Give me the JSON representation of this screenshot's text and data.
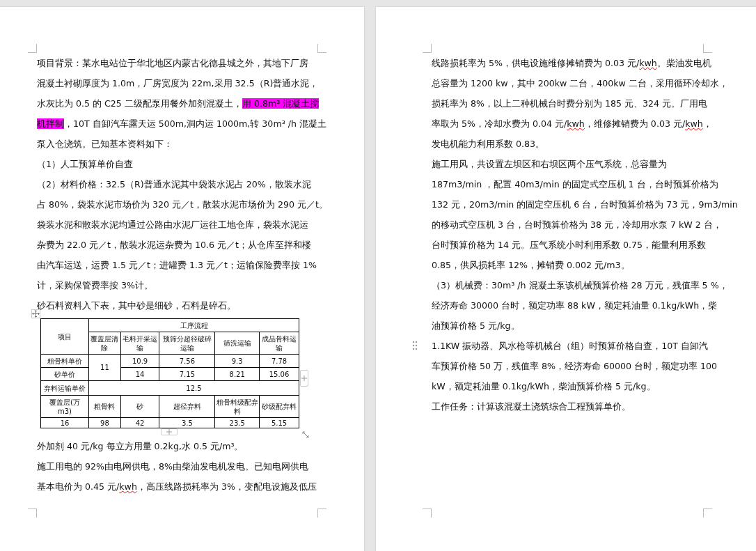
{
  "pages": [
    {
      "blocks": [
        {
          "kind": "paragraph",
          "lines": [
            [
              "项目背景：某水电站位于华北地区内蒙古化德县城之外，其地下厂房"
            ],
            [
              "混凝土衬砌厚度为 1.0m，厂房宽度为 22m,采用 32.5（R)普通水泥，"
            ],
            [
              "水灰比为 0.5 的 C25 二级配泵用餐外加剂混凝土，",
              {
                "text": "用 0.8m³ 混凝土搅",
                "highlight": true
              }
            ],
            [
              {
                "text": "机拌制",
                "highlight": true
              },
              "，10T 自卸汽车露天运 500m,洞内运 1000m,转 30m³ /h 混凝土"
            ],
            [
              "泵入仓浇筑。已知基本资料如下："
            ]
          ]
        },
        {
          "kind": "paragraph",
          "lines": [
            [
              "（1）人工预算单价自查"
            ]
          ]
        },
        {
          "kind": "paragraph",
          "lines": [
            [
              "（2）材料价格：32.5（R)普通水泥其中袋装水泥占 20%，散装水泥"
            ],
            [
              "占 80%，袋装水泥市场价为 320 元／t，散装水泥市场价为 290 元／t。"
            ],
            [
              "袋装水泥和散装水泥均通过公路由水泥厂运往工地仓库，袋装水泥运"
            ],
            [
              "杂费为 22.0 元／t，散装水泥运杂费为 10.6 元／t；从仓库至拌和楼"
            ],
            [
              "由汽车运送，运费 1.5 元／t；进罐费 1.3 元／t；运输保险费率按 1%"
            ],
            [
              "计，采购保管费率按 3%计。"
            ]
          ]
        },
        {
          "kind": "paragraph",
          "lines": [
            [
              "砂石料资料入下表，其中砂是细砂，石料是碎石。"
            ]
          ]
        },
        {
          "kind": "table",
          "rows": [
            [
              {
                "text": "项目",
                "rowspan": 2
              },
              {
                "text": "工序流程",
                "colspan": 5
              }
            ],
            [
              {
                "text": "覆盖层清除"
              },
              {
                "text": "毛料开采运输"
              },
              {
                "text": "预筛分超径破碎运输"
              },
              {
                "text": "筛洗运输"
              },
              {
                "text": "成品骨料运输"
              }
            ],
            [
              {
                "text": "粗骨料单价"
              },
              {
                "text": "11",
                "rowspan": 2
              },
              {
                "text": "10.9"
              },
              {
                "text": "7.56"
              },
              {
                "text": "9.3"
              },
              {
                "text": "7.78"
              }
            ],
            [
              {
                "text": "砂单价"
              },
              {
                "text": "14"
              },
              {
                "text": "7.15"
              },
              {
                "text": "8.21"
              },
              {
                "text": "15.06"
              }
            ],
            [
              {
                "text": "弃料运输单价"
              },
              {
                "text": "12.5",
                "colspan": 5
              }
            ],
            [
              {
                "text": "覆盖层(万 m3)"
              },
              {
                "text": "粗骨料"
              },
              {
                "text": "砂"
              },
              {
                "text": "超径弃料"
              },
              {
                "text": "粗骨料级配弃料"
              },
              {
                "text": "砂级配弃料"
              }
            ],
            [
              {
                "text": "16"
              },
              {
                "text": "98"
              },
              {
                "text": "42"
              },
              {
                "text": "3.5"
              },
              {
                "text": "23.5"
              },
              {
                "text": "5.15"
              }
            ]
          ]
        },
        {
          "kind": "paragraph",
          "lines": [
            [
              "外加剂 40 元/kg 每立方用量 0.2kg,水 0.5 元/m³。"
            ]
          ]
        },
        {
          "kind": "paragraph",
          "lines": [
            [
              "施工用电的 92%由电网供电，8%由柴油发电机发电。已知电网供电"
            ],
            [
              "基本电价为 0.45 元/",
              {
                "text": "kwh",
                "misspelled": true
              },
              "，高压线路损耗率为 3%，变配电设施及低压"
            ]
          ]
        }
      ]
    },
    {
      "blocks": [
        {
          "kind": "paragraph",
          "lines": [
            [
              "线路损耗率为 5%，供电设施维修摊销费为 0.03 元/",
              {
                "text": "kwh",
                "misspelled": true
              },
              "。柴油发电机"
            ],
            [
              "总容量为 1200 kw，其中 200kw 二台，400kw 二台，采用循环冷却水，"
            ],
            [
              "损耗率为 8%，以上二种机械台时费分别为 185 元、324 元。厂用电"
            ],
            [
              "率取为 5%，冷却水费为 0.04 元/",
              {
                "text": "kwh",
                "misspelled": true
              },
              "，维修摊销费为 0.03 元/",
              {
                "text": "kwh",
                "misspelled": true
              },
              "，"
            ],
            [
              "发电机能力利用系数 0.83。"
            ]
          ]
        },
        {
          "kind": "paragraph",
          "lines": [
            [
              "施工用风，共设置左坝区和右坝区两个压气系统，总容量为"
            ],
            [
              "187m3/min ，配置 40m3/min 的固定式空压机 1 台，台时预算价格为"
            ],
            [
              "132 元，20m3/min 的固定空压机 6 台，台时预算价格为 73 元，9m3/min"
            ],
            [
              "的移动式空压机 3 台，台时预算价格为 38 元，冷却用水泵 7 kW 2 台，"
            ],
            [
              "台时预算价格为 14 元。压气系统小时利用系数 0.75，能量利用系数"
            ],
            [
              "0.85，供风损耗率 12%，摊销费 0.002 元/m3。"
            ]
          ]
        },
        {
          "kind": "paragraph",
          "lines": [
            [
              "（3）机械费：30m³ /h 混凝土泵该机械预算价格 28 万元，残值率 5 %，"
            ],
            [
              "经济寿命 30000 台时，额定功率 88 kW，额定耗油量 0.1kg/kWh，柴"
            ],
            [
              "油预算价格 5 元/kg。"
            ]
          ]
        },
        {
          "kind": "paragraph",
          "handle": true,
          "lines": [
            [
              "1.1KW 振动器、风水枪等机械台（组）时预算价格自查，10T 自卸汽"
            ],
            [
              "车预算价格 50 万，残值率 8%，经济寿命 60000 台时，额定功率 100"
            ],
            [
              "kW，额定耗油量 0.1kg/kWh，柴油预算价格 5 元/kg。"
            ]
          ]
        },
        {
          "kind": "paragraph",
          "lines": [
            [
              "工作任务：计算该混凝土浇筑综合工程预算单价。"
            ]
          ]
        }
      ]
    }
  ]
}
